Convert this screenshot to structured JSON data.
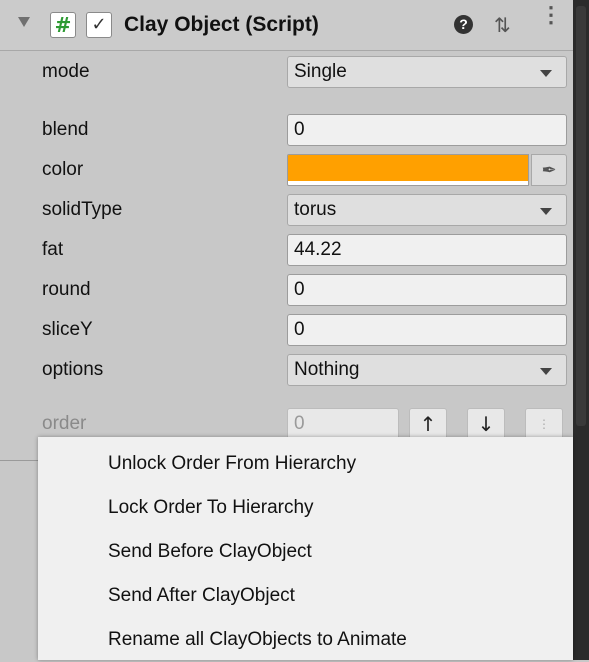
{
  "header": {
    "title": "Clay Object (Script)",
    "script_icon": "#",
    "enabled_check": "✓",
    "help_icon": "?",
    "presets_icon": "⇅",
    "menu_icon": "⋮"
  },
  "properties": {
    "mode": {
      "label": "mode",
      "value": "Single"
    },
    "blend": {
      "label": "blend",
      "value": "0"
    },
    "color": {
      "label": "color",
      "value": "#ffa000"
    },
    "solidType": {
      "label": "solidType",
      "value": "torus"
    },
    "fat": {
      "label": "fat",
      "value": "44.22"
    },
    "round": {
      "label": "round",
      "value": "0"
    },
    "sliceY": {
      "label": "sliceY",
      "value": "0"
    },
    "options": {
      "label": "options",
      "value": "Nothing"
    },
    "order": {
      "label": "order",
      "value": "0",
      "up": "↑",
      "down": "↓",
      "more": "⋮"
    }
  },
  "eyedropper_icon": "✒",
  "context_menu": {
    "items": [
      "Unlock Order From Hierarchy",
      "Lock Order To Hierarchy",
      "Send Before ClayObject",
      "Send After ClayObject",
      "Rename all ClayObjects to Animate"
    ]
  }
}
